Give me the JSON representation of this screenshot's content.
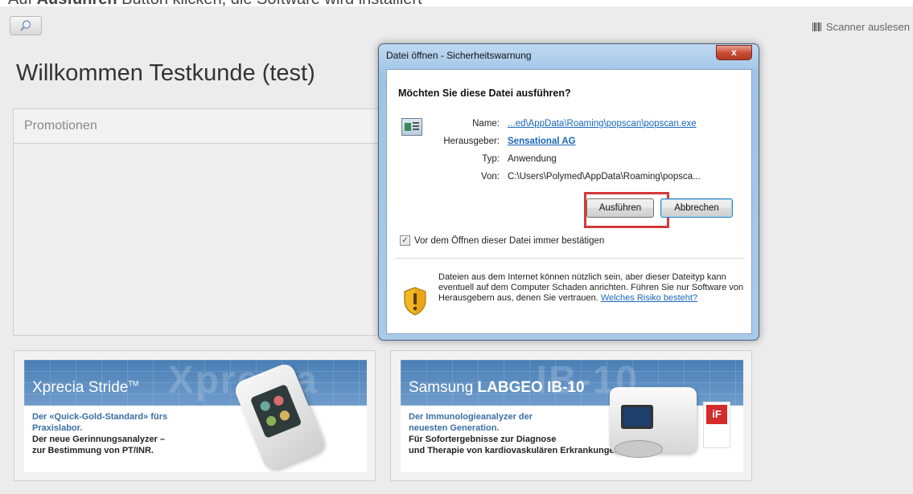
{
  "caption": {
    "prefix": "Auf ",
    "bold": "Ausführen",
    "suffix": " Button klicken, die Software wird installiert"
  },
  "header": {
    "scanner_label": "Scanner auslesen"
  },
  "welcome_text": "Willkommen Testkunde (test)",
  "promotions_title": "Promotionen",
  "banners": [
    {
      "watermark": "Xprecia",
      "title_regular": "Xprecia Stride",
      "title_tm": "TM",
      "line1": "Der «Quick-Gold-Standard» fürs",
      "line2": "Praxislabor.",
      "line3": "Der neue Gerinnungsanalyzer –",
      "line4": "zur Bestimmung von PT/INR."
    },
    {
      "watermark": "IB-10",
      "title_regular": "Samsung ",
      "title_bold": "LABGEO IB-10",
      "line1": "Der Immunologieanalyzer der",
      "line2": "neuesten Generation.",
      "line3": "Für Sofortergebnisse zur Diagnose",
      "line4": "und Therapie von kardiovaskulären Erkrankungen.",
      "badge": "iF"
    }
  ],
  "dialog": {
    "title": "Datei öffnen - Sicherheitswarnung",
    "close_glyph": "x",
    "question": "Möchten Sie diese Datei ausführen?",
    "fields": [
      {
        "label": "Name:",
        "value": "...ed\\AppData\\Roaming\\popscan\\popscan.exe"
      },
      {
        "label": "Herausgeber:",
        "value": "Sensational AG"
      },
      {
        "label": "Typ:",
        "value": "Anwendung"
      },
      {
        "label": "Von:",
        "value": "C:\\Users\\Polymed\\AppData\\Roaming\\popsca..."
      }
    ],
    "run_label": "Ausführen",
    "cancel_label": "Abbrechen",
    "checkbox_label": "Vor dem Öffnen dieser Datei immer bestätigen",
    "checkbox_checked": true,
    "warning_text": "Dateien aus dem Internet können nützlich sein, aber dieser Dateityp kann eventuell auf dem Computer Schaden anrichten. Führen Sie nur Software von Herausgebern aus, denen Sie vertrauen. ",
    "warning_link": "Welches Risiko besteht?"
  }
}
